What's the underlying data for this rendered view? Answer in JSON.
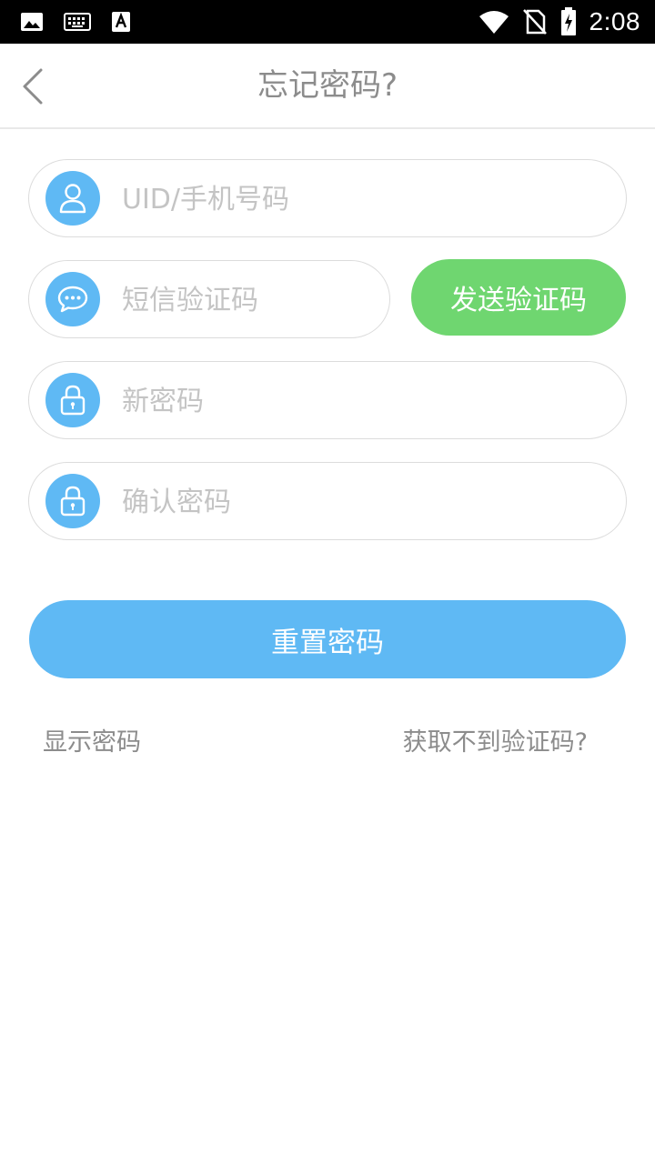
{
  "status_bar": {
    "time": "2:08",
    "icons": [
      "image-icon",
      "keyboard-icon",
      "text-a-icon",
      "wifi-icon",
      "no-sim-icon",
      "battery-charging-icon"
    ]
  },
  "header": {
    "title": "忘记密码?",
    "back_icon": "chevron-left-icon"
  },
  "form": {
    "uid": {
      "placeholder": "UID/手机号码",
      "value": "",
      "icon": "user-icon"
    },
    "sms_code": {
      "placeholder": "短信验证码",
      "value": "",
      "icon": "chat-bubble-icon"
    },
    "send_code_label": "发送验证码",
    "new_password": {
      "placeholder": "新密码",
      "value": "",
      "icon": "lock-icon"
    },
    "confirm_password": {
      "placeholder": "确认密码",
      "value": "",
      "icon": "lock-icon"
    },
    "reset_label": "重置密码"
  },
  "links": {
    "show_password": "显示密码",
    "cannot_get_code": "获取不到验证码?"
  },
  "colors": {
    "accent_blue": "#5fb9f4",
    "send_green": "#6fd670",
    "text_gray": "#8c8c8c",
    "placeholder_gray": "#c4c4c4"
  }
}
